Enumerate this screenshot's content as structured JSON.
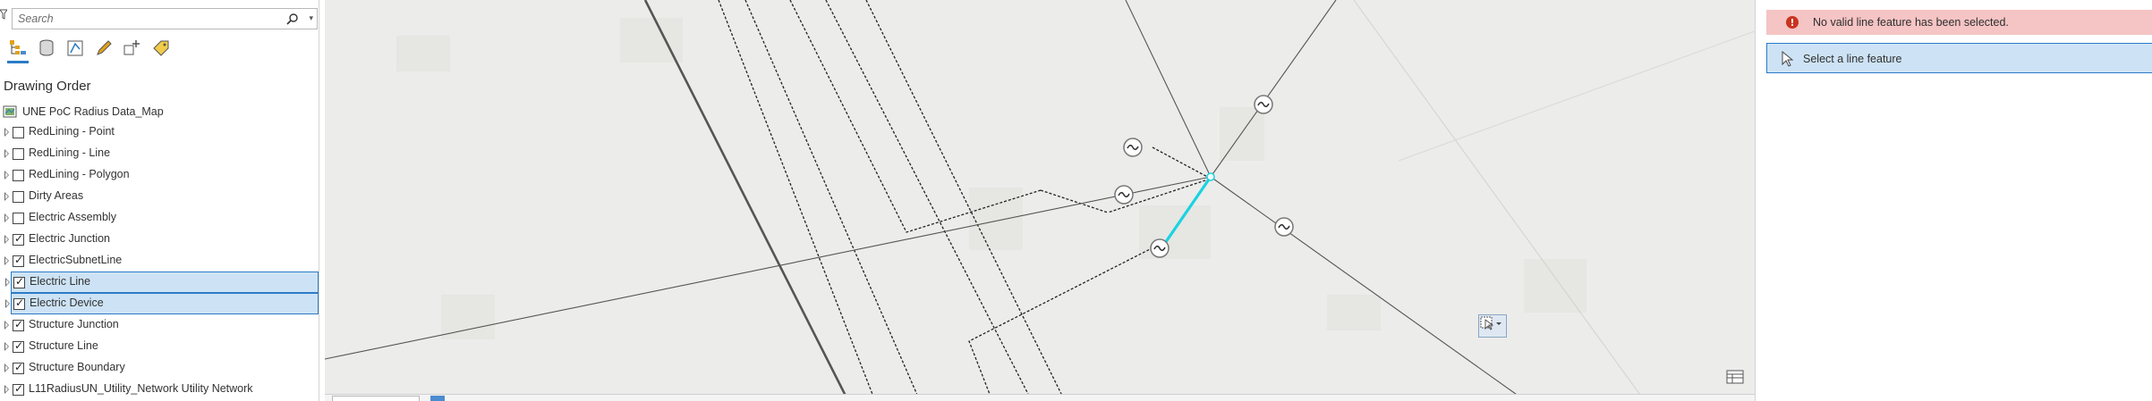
{
  "contents": {
    "search_placeholder": "Search",
    "heading": "Drawing Order",
    "map_name": "UNE PoC Radius Data_Map",
    "layers": [
      {
        "label": "RedLining - Point",
        "checked": false,
        "selected": false
      },
      {
        "label": "RedLining - Line",
        "checked": false,
        "selected": false
      },
      {
        "label": "RedLining - Polygon",
        "checked": false,
        "selected": false
      },
      {
        "label": "Dirty Areas",
        "checked": false,
        "selected": false
      },
      {
        "label": "Electric Assembly",
        "checked": false,
        "selected": false
      },
      {
        "label": "Electric Junction",
        "checked": true,
        "selected": false
      },
      {
        "label": "ElectricSubnetLine",
        "checked": true,
        "selected": false
      },
      {
        "label": "Electric Line",
        "checked": true,
        "selected": true
      },
      {
        "label": "Electric Device",
        "checked": true,
        "selected": true
      },
      {
        "label": "Structure Junction",
        "checked": true,
        "selected": false
      },
      {
        "label": "Structure Line",
        "checked": true,
        "selected": false
      },
      {
        "label": "Structure Boundary",
        "checked": true,
        "selected": false
      },
      {
        "label": "L11RadiusUN_Utility_Network Utility Network",
        "checked": true,
        "selected": false
      }
    ],
    "toolbar_icons": [
      "list-by-drawing-order-icon",
      "list-by-source-icon",
      "list-by-selection-icon",
      "list-by-editing-icon",
      "list-by-snapping-icon",
      "list-by-labeling-icon"
    ]
  },
  "messages": {
    "error_text": "No valid line feature has been selected.",
    "prompt_text": "Select a line feature"
  },
  "colors": {
    "accent": "#2b7bc6",
    "selection_fill": "#cde3f5",
    "error_fill": "#f5c4c4",
    "error_icon": "#c9341f",
    "highlight_line": "#19d3e0",
    "map_background": "#ececea"
  }
}
